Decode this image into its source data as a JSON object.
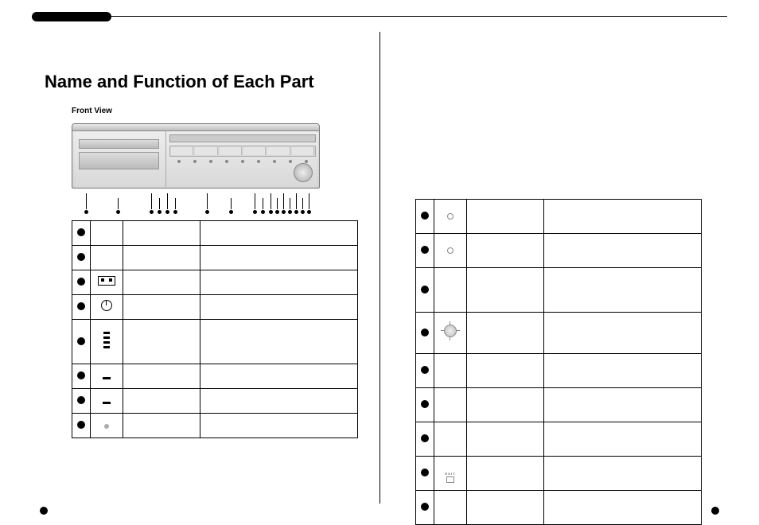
{
  "section_title": "Name and Function of Each Part",
  "subhead": "Front View",
  "left_table": {
    "rows": [
      {
        "id": 1,
        "icon": "",
        "name": "",
        "desc": ""
      },
      {
        "id": 2,
        "icon": "",
        "name": "",
        "desc": ""
      },
      {
        "id": 3,
        "icon": "usb-rect",
        "name": "",
        "desc": ""
      },
      {
        "id": 4,
        "icon": "power-circle",
        "name": "",
        "desc": ""
      },
      {
        "id": 5,
        "icon": "bars-4",
        "name": "",
        "desc": ""
      },
      {
        "id": 6,
        "icon": "bar-1",
        "name": "",
        "desc": ""
      },
      {
        "id": 7,
        "icon": "bar-1",
        "name": "",
        "desc": ""
      },
      {
        "id": 8,
        "icon": "led-dot",
        "name": "",
        "desc": ""
      }
    ]
  },
  "right_table": {
    "rows": [
      {
        "id": 9,
        "icon": "led-hollow",
        "name": "",
        "desc": ""
      },
      {
        "id": 10,
        "icon": "led-hollow",
        "name": "",
        "desc": ""
      },
      {
        "id": 11,
        "icon": "",
        "name": "",
        "desc": ""
      },
      {
        "id": 12,
        "icon": "jog-dial",
        "name": "",
        "desc": ""
      },
      {
        "id": 13,
        "icon": "",
        "name": "",
        "desc": ""
      },
      {
        "id": 14,
        "icon": "",
        "name": "",
        "desc": ""
      },
      {
        "id": 15,
        "icon": "",
        "name": "",
        "desc": ""
      },
      {
        "id": 16,
        "icon": "exit-label",
        "name": "",
        "desc": ""
      },
      {
        "id": 17,
        "icon": "",
        "name": "",
        "desc": ""
      }
    ]
  }
}
